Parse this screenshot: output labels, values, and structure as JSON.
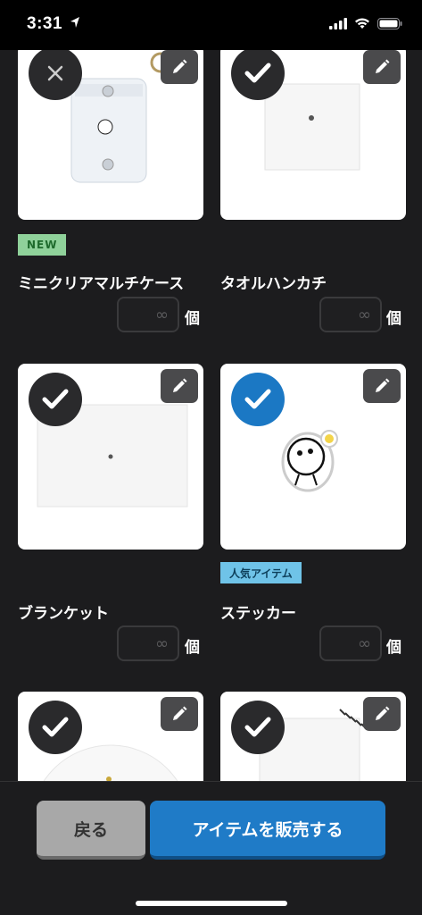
{
  "status": {
    "time": "3:31"
  },
  "items": [
    {
      "name": "ミニクリアマルチケース",
      "badge": "NEW",
      "qty_placeholder": "∞",
      "unit": "個",
      "selected": false
    },
    {
      "name": "タオルハンカチ",
      "badge": "",
      "qty_placeholder": "∞",
      "unit": "個",
      "selected": false
    },
    {
      "name": "ブランケット",
      "badge": "",
      "qty_placeholder": "∞",
      "unit": "個",
      "selected": false
    },
    {
      "name": "ステッカー",
      "badge": "人気アイテム",
      "qty_placeholder": "∞",
      "unit": "個",
      "selected": true
    },
    {
      "name": "",
      "badge": "",
      "selected": false
    },
    {
      "name": "",
      "badge": "",
      "selected": false
    }
  ],
  "buttons": {
    "back": "戻る",
    "sell": "アイテムを販売する"
  },
  "colors": {
    "accent": "#1f7bc7",
    "new_badge": "#8fd19a",
    "popular_badge": "#6fc3e8"
  },
  "icons": [
    "location-arrow-icon",
    "signal-icon",
    "wifi-icon",
    "battery-icon",
    "check-icon",
    "close-icon",
    "pencil-icon"
  ]
}
